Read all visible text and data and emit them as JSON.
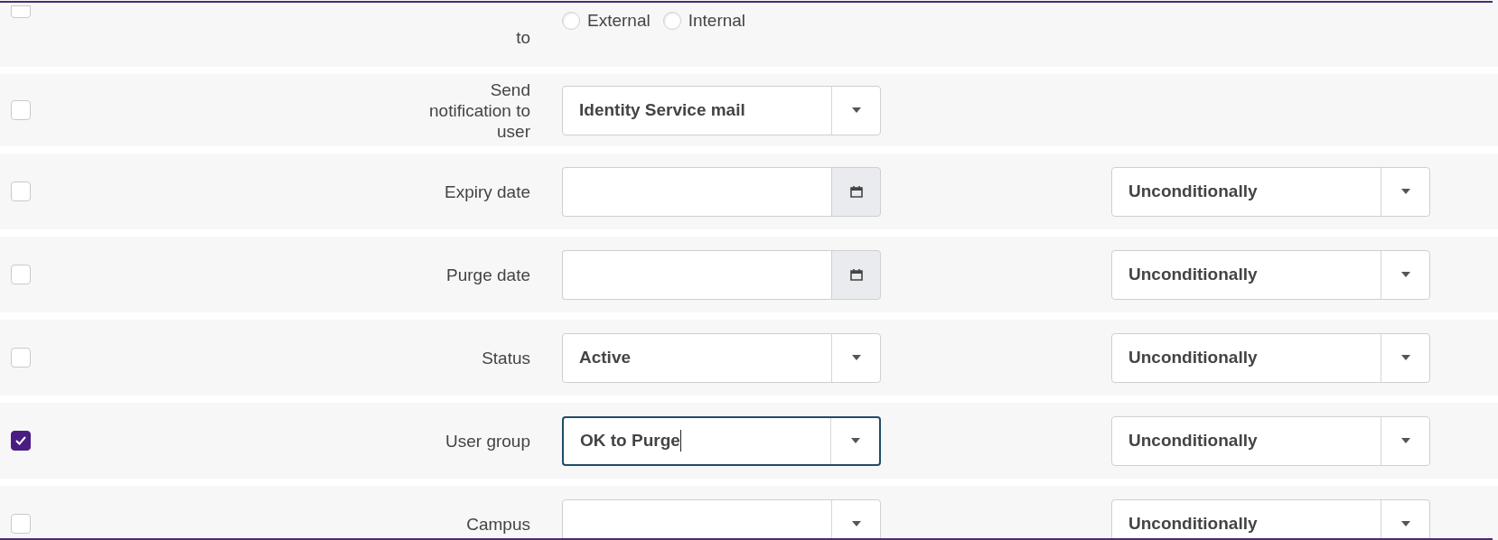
{
  "rows": [
    {
      "checked": false,
      "label": "to",
      "control": {
        "kind": "radios",
        "options": [
          {
            "label": "External",
            "selected": false
          },
          {
            "label": "Internal",
            "selected": false
          }
        ]
      }
    },
    {
      "checked": false,
      "label": "Send notification to user",
      "control": {
        "kind": "select",
        "value": "Identity Service mail",
        "focused": false
      }
    },
    {
      "checked": false,
      "label": "Expiry date",
      "control": {
        "kind": "date"
      },
      "condition": "Unconditionally"
    },
    {
      "checked": false,
      "label": "Purge date",
      "control": {
        "kind": "date"
      },
      "condition": "Unconditionally"
    },
    {
      "checked": false,
      "label": "Status",
      "control": {
        "kind": "select",
        "value": "Active",
        "focused": false
      },
      "condition": "Unconditionally"
    },
    {
      "checked": true,
      "label": "User group",
      "control": {
        "kind": "select",
        "value": "OK to Purge",
        "focused": true
      },
      "condition": "Unconditionally"
    },
    {
      "checked": false,
      "label": "Campus",
      "control": {
        "kind": "select",
        "focused": false
      },
      "condition": "Unconditionally"
    }
  ]
}
